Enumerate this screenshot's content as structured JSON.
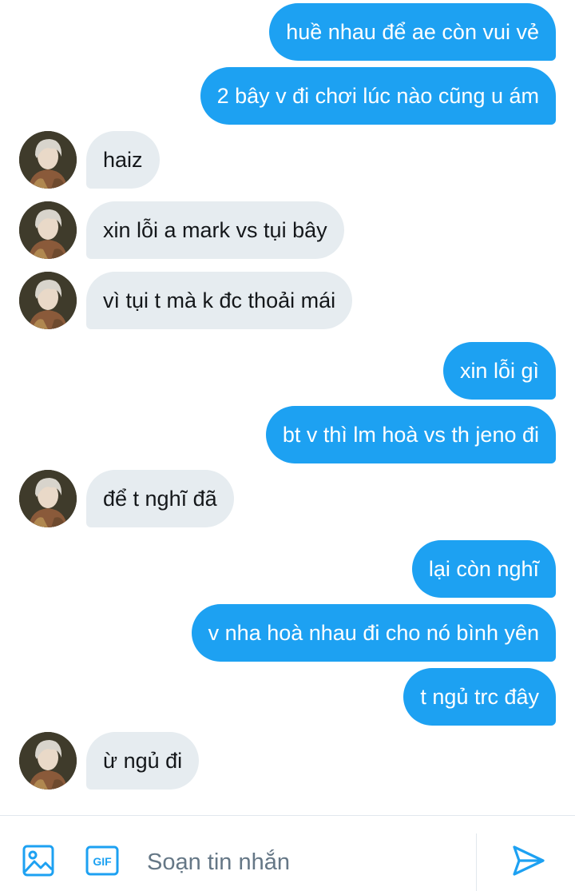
{
  "conversation": {
    "messages": [
      {
        "direction": "sent",
        "text": "huề nhau để ae còn vui vẻ"
      },
      {
        "direction": "sent",
        "text": "2 bây v đi chơi lúc nào cũng u ám"
      },
      {
        "direction": "received",
        "text": "haiz"
      },
      {
        "direction": "received",
        "text": "xin lỗi a mark vs tụi bây"
      },
      {
        "direction": "received",
        "text": "vì tụi t mà k đc thoải mái"
      },
      {
        "direction": "sent",
        "text": "xin lỗi gì"
      },
      {
        "direction": "sent",
        "text": "bt v thì lm hoà vs th jeno đi"
      },
      {
        "direction": "received",
        "text": "để t nghĩ đã"
      },
      {
        "direction": "sent",
        "text": "lại còn nghĩ"
      },
      {
        "direction": "sent",
        "text": "v nha hoà nhau đi cho nó bình yên"
      },
      {
        "direction": "sent",
        "text": "t ngủ trc đây"
      },
      {
        "direction": "received",
        "text": "ừ ngủ đi"
      }
    ]
  },
  "composer": {
    "placeholder": "Soạn tin nhắn",
    "gif_label": "GIF",
    "icons": {
      "media": "image-icon",
      "gif": "gif-icon",
      "send": "send-icon"
    }
  },
  "colors": {
    "accent": "#1da1f2",
    "received_bubble": "#e6ecf0",
    "received_text": "#14171a",
    "placeholder": "#657786"
  }
}
